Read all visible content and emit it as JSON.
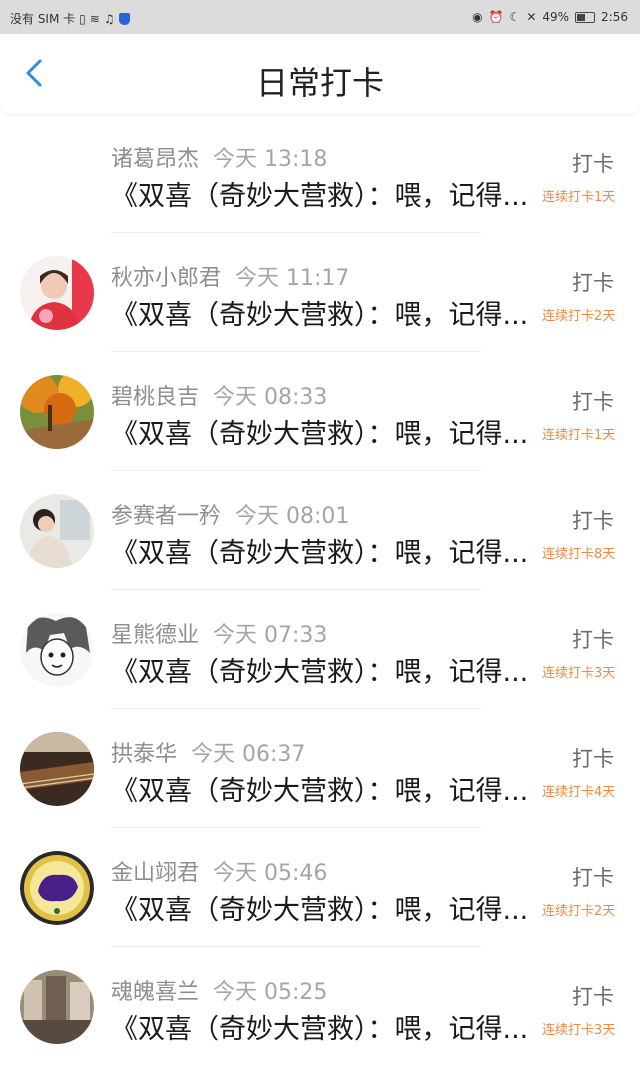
{
  "status_bar": {
    "carrier": "没有 SIM 卡",
    "battery": "49%",
    "time": "2:56"
  },
  "header": {
    "title": "日常打卡"
  },
  "checkins": [
    {
      "name": "诸葛昂杰",
      "time": "今天 13:18",
      "message": "《双喜（奇妙大营救）：喂，记得...",
      "action": "打卡",
      "streak": "连续打卡1天"
    },
    {
      "name": "秋亦小郎君",
      "time": "今天 11:17",
      "message": "《双喜（奇妙大营救）：喂，记得...",
      "action": "打卡",
      "streak": "连续打卡2天"
    },
    {
      "name": "碧桃良吉",
      "time": "今天 08:33",
      "message": "《双喜（奇妙大营救）：喂，记得...",
      "action": "打卡",
      "streak": "连续打卡1天"
    },
    {
      "name": "参赛者一矜",
      "time": "今天 08:01",
      "message": "《双喜（奇妙大营救）：喂，记得...",
      "action": "打卡",
      "streak": "连续打卡8天"
    },
    {
      "name": "星熊德业",
      "time": "今天 07:33",
      "message": "《双喜（奇妙大营救）：喂，记得...",
      "action": "打卡",
      "streak": "连续打卡3天"
    },
    {
      "name": "拱泰华",
      "time": "今天 06:37",
      "message": "《双喜（奇妙大营救）：喂，记得...",
      "action": "打卡",
      "streak": "连续打卡4天"
    },
    {
      "name": "金山翊君",
      "time": "今天 05:46",
      "message": "《双喜（奇妙大营救）：喂，记得...",
      "action": "打卡",
      "streak": "连续打卡2天"
    },
    {
      "name": "魂魄喜兰",
      "time": "今天 05:25",
      "message": "《双喜（奇妙大营救）：喂，记得...",
      "action": "打卡",
      "streak": "连续打卡3天"
    }
  ],
  "colors": {
    "accent": "#2a8de0",
    "streak": "#ef8a43",
    "status_bar_bg": "#dcdcdc"
  }
}
